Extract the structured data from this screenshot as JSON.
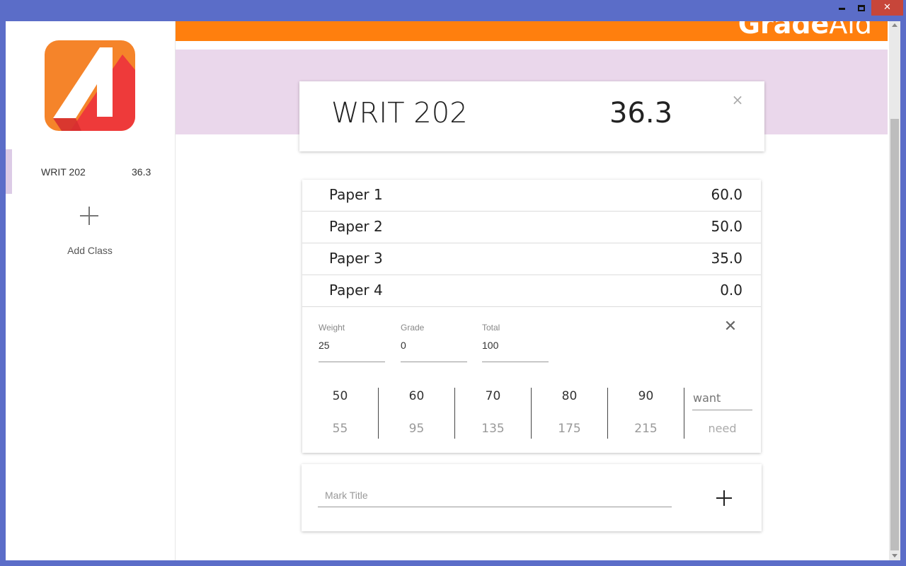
{
  "window": {
    "close_glyph": "✕"
  },
  "app": {
    "brand_bold": "Grade",
    "brand_light": "Aid",
    "accent_color": "#ff7f0e",
    "header_band_color": "#ead7eb"
  },
  "sidebar": {
    "classes": [
      {
        "name": "WRIT 202",
        "grade": "36.3"
      }
    ],
    "add_class_label": "Add Class"
  },
  "class_header": {
    "title": "WRIT 202",
    "grade": "36.3",
    "close_glyph": "×"
  },
  "marks": [
    {
      "title": "Paper 1",
      "value": "60.0"
    },
    {
      "title": "Paper 2",
      "value": "50.0"
    },
    {
      "title": "Paper 3",
      "value": "35.0"
    },
    {
      "title": "Paper 4",
      "value": "0.0"
    }
  ],
  "edit_panel": {
    "weight_label": "Weight",
    "weight_value": "25",
    "grade_label": "Grade",
    "grade_value": "0",
    "total_label": "Total",
    "total_value": "100",
    "close_glyph": "✕",
    "targets": [
      {
        "want": "50",
        "need": "55"
      },
      {
        "want": "60",
        "need": "95"
      },
      {
        "want": "70",
        "need": "135"
      },
      {
        "want": "80",
        "need": "175"
      },
      {
        "want": "90",
        "need": "215"
      }
    ],
    "want_placeholder": "want",
    "need_label": "need"
  },
  "add_mark": {
    "placeholder": "Mark Title"
  }
}
